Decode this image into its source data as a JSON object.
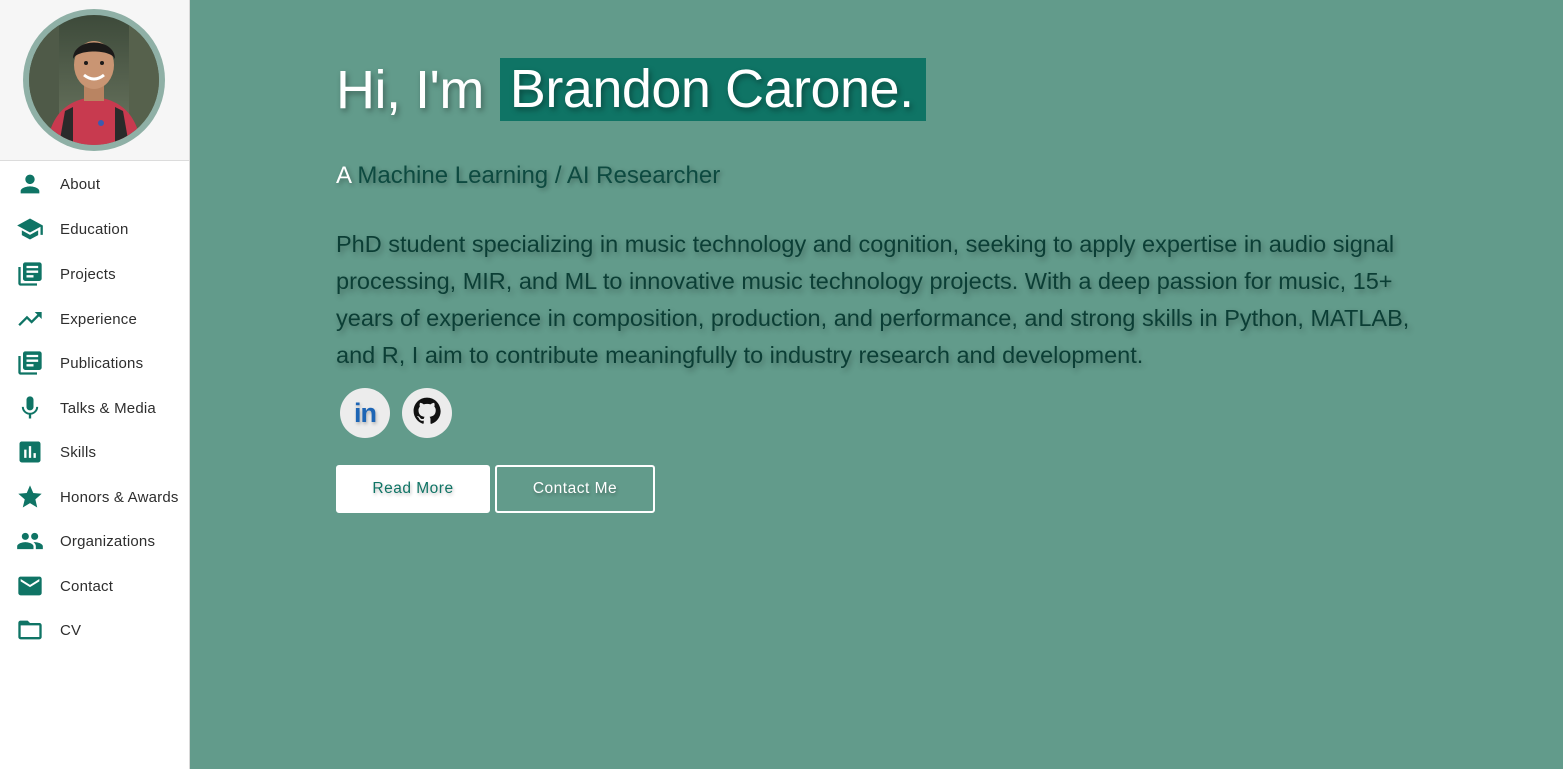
{
  "brand": {
    "accent": "#0f7465",
    "background": "#629b8b",
    "sidebar_bg": "#ffffff"
  },
  "sidebar": {
    "avatar_alt": "Profile photo",
    "items": [
      {
        "label": "About",
        "icon": "person-icon"
      },
      {
        "label": "Education",
        "icon": "graduation-cap-icon"
      },
      {
        "label": "Projects",
        "icon": "library-books-icon"
      },
      {
        "label": "Experience",
        "icon": "trending-up-icon"
      },
      {
        "label": "Publications",
        "icon": "library-books-icon"
      },
      {
        "label": "Talks & Media",
        "icon": "microphone-icon"
      },
      {
        "label": "Skills",
        "icon": "bar-chart-icon"
      },
      {
        "label": "Honors & Awards",
        "icon": "star-icon"
      },
      {
        "label": "Organizations",
        "icon": "people-icon"
      },
      {
        "label": "Contact",
        "icon": "mail-icon"
      },
      {
        "label": "CV",
        "icon": "folder-icon"
      }
    ]
  },
  "hero": {
    "greeting": "Hi, I'm",
    "name": "Brandon Carone.",
    "subtitle_prefix": "A",
    "subtitle_role": "Machine Learning / AI Researcher",
    "description": "PhD student specializing in music technology and cognition, seeking to apply expertise in audio signal processing, MIR, and ML to innovative music technology projects. With a deep passion for music, 15+ years of experience in composition, production, and performance, and strong skills in Python, MATLAB, and R, I aim to contribute meaningfully to industry research and development.",
    "social": [
      {
        "name": "LinkedIn",
        "icon": "linkedin-icon",
        "text": "in"
      },
      {
        "name": "GitHub",
        "icon": "github-icon"
      }
    ],
    "buttons": {
      "read_more": "Read More",
      "contact_me": "Contact Me"
    }
  }
}
